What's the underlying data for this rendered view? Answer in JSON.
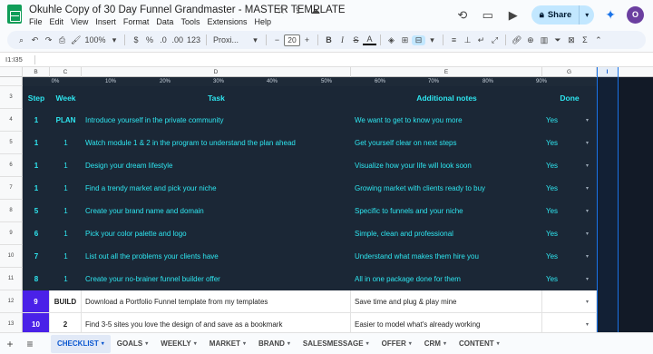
{
  "title_bar": {
    "doc_title": "Okuhle Copy of 30 Day Funnel Grandmaster - MASTER TEMPLATE",
    "menu": [
      "File",
      "Edit",
      "View",
      "Insert",
      "Format",
      "Data",
      "Tools",
      "Extensions",
      "Help"
    ],
    "share_label": "Share",
    "avatar_initial": "O"
  },
  "toolbar": {
    "zoom": "100%",
    "currency": "$",
    "percent": "%",
    "dec_decrease": ".0",
    "dec_increase": ".00",
    "number_format": "123",
    "font": "Proxi...",
    "font_size": "20"
  },
  "formula_bar": {
    "name_box": "I1:I35"
  },
  "grid": {
    "columns": [
      "B",
      "C",
      "D",
      "E",
      "G",
      "I"
    ],
    "ruler": [
      "0%",
      "10%",
      "20%",
      "30%",
      "40%",
      "50%",
      "60%",
      "70%",
      "80%",
      "90%"
    ],
    "header_row": {
      "row": "3",
      "step": "Step",
      "week": "Week",
      "task": "Task",
      "notes": "Additional notes",
      "done": "Done"
    },
    "rows": [
      {
        "row": "4",
        "step": "1",
        "week": "PLAN",
        "task": "Introduce yourself in the private community",
        "notes": "We want to get to know you more",
        "done": "Yes",
        "style": "dark"
      },
      {
        "row": "5",
        "step": "1",
        "week": "1",
        "task": "Watch module 1 & 2 in the program to understand the plan ahead",
        "notes": "Get yourself clear on next steps",
        "done": "Yes",
        "style": "dark"
      },
      {
        "row": "6",
        "step": "1",
        "week": "1",
        "task": "Design your dream lifestyle",
        "notes": "Visualize how your life will look soon",
        "done": "Yes",
        "style": "dark"
      },
      {
        "row": "7",
        "step": "1",
        "week": "1",
        "task": "Find a trendy market and pick your niche",
        "notes": "Growing market with clients ready to buy",
        "done": "Yes",
        "style": "dark"
      },
      {
        "row": "8",
        "step": "5",
        "week": "1",
        "task": "Create your brand name and domain",
        "notes": "Specific to funnels and your niche",
        "done": "Yes",
        "style": "dark"
      },
      {
        "row": "9",
        "step": "6",
        "week": "1",
        "task": "Pick your color palette and logo",
        "notes": "Simple, clean and professional",
        "done": "Yes",
        "style": "dark"
      },
      {
        "row": "10",
        "step": "7",
        "week": "1",
        "task": "List out all the problems your clients have",
        "notes": "Understand what makes them hire you",
        "done": "Yes",
        "style": "dark"
      },
      {
        "row": "11",
        "step": "8",
        "week": "1",
        "task": "Create your no-brainer funnel builder offer",
        "notes": "All in one package done for them",
        "done": "Yes",
        "style": "dark"
      },
      {
        "row": "12",
        "step": "9",
        "week": "BUILD",
        "task": "Download a Portfolio Funnel template from my templates",
        "notes": "Save time and plug & play mine",
        "done": "",
        "style": "light"
      },
      {
        "row": "13",
        "step": "10",
        "week": "2",
        "task": "Find 3-5 sites you love the design of and save as a bookmark",
        "notes": "Easier to model what's already working",
        "done": "",
        "style": "light"
      }
    ]
  },
  "sheet_tabs": [
    "CHECKLIST",
    "GOALS",
    "WEEKLY",
    "MARKET",
    "BRAND",
    "SALESMESSAGE",
    "OFFER",
    "CRM",
    "CONTENT"
  ],
  "colors": {
    "dark_row_bg": "#1b2736",
    "cyan_text": "#2ee6f0",
    "step_purple": "#4a21e8",
    "active_tab": "#0b57d0",
    "share_bg": "#c2e7ff"
  },
  "icons": [
    "sheets-logo-icon",
    "star-icon",
    "move-icon",
    "cloud-icon",
    "history-icon",
    "comment-icon",
    "meet-icon",
    "lock-icon",
    "gemini-icon",
    "search-icon",
    "undo-icon",
    "redo-icon",
    "print-icon",
    "paint-format-icon",
    "add-sheet-icon",
    "sheet-list-icon"
  ]
}
